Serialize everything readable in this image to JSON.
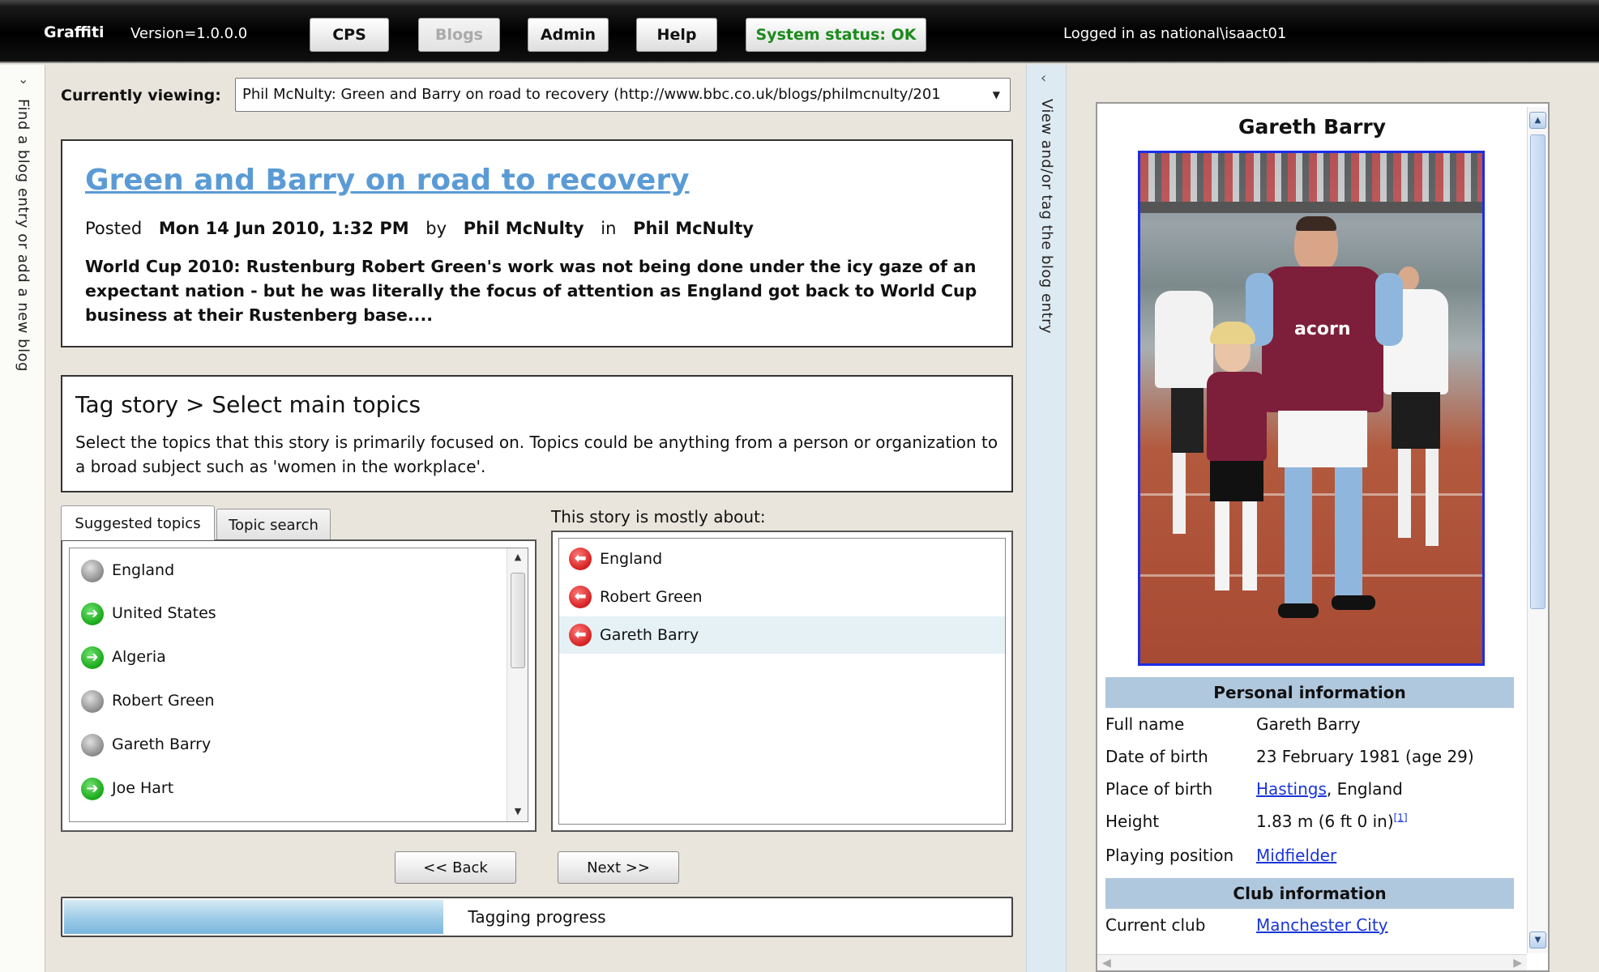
{
  "app": {
    "name": "Graffiti",
    "version": "Version=1.0.0.0",
    "nav": [
      "CPS",
      "Blogs",
      "Admin",
      "Help"
    ],
    "status": "System status: OK",
    "logged_in": "Logged in as national\\isaact01"
  },
  "rails": {
    "left": "Find a blog entry or add a new blog",
    "middle": "View and/or tag the blog entry"
  },
  "viewing": {
    "label": "Currently viewing:",
    "value": "Phil McNulty: Green and Barry on road to recovery (http://www.bbc.co.uk/blogs/philmcnulty/201"
  },
  "article": {
    "title": "Green and Barry on road to recovery",
    "posted_label": "Posted",
    "date": "Mon 14 Jun 2010, 1:32 PM",
    "by_label": "by",
    "author": "Phil McNulty",
    "in_label": "in",
    "blog": "Phil McNulty",
    "summary": "World Cup 2010: Rustenburg Robert Green's work was not being done under the icy gaze of an expectant nation - but he was literally the focus of attention as England got back to World Cup business at their Rustenberg base...."
  },
  "tag_step": {
    "crumb": "Tag story >  Select main topics",
    "description": "Select the topics that this story is primarily focused on. Topics could be anything from a person or organization to a broad subject such as 'women in the workplace'."
  },
  "tabs": [
    "Suggested topics",
    "Topic search"
  ],
  "suggested": [
    {
      "label": "England",
      "state": "grey"
    },
    {
      "label": "United States",
      "state": "green"
    },
    {
      "label": "Algeria",
      "state": "green"
    },
    {
      "label": "Robert Green",
      "state": "grey"
    },
    {
      "label": "Gareth Barry",
      "state": "grey"
    },
    {
      "label": "Joe Hart",
      "state": "green"
    }
  ],
  "about": {
    "label": "This story is mostly about:",
    "items": [
      "England",
      "Robert Green",
      "Gareth Barry"
    ]
  },
  "buttons": {
    "back": "<< Back",
    "next": "Next >>"
  },
  "progress": {
    "label": "Tagging progress",
    "fraction": 0.4
  },
  "wiki": {
    "name": "Gareth Barry",
    "personal_header": "Personal information",
    "full_name_k": "Full name",
    "full_name_v": "Gareth Barry",
    "dob_k": "Date of birth",
    "dob_v": "23 February 1981 (age 29)",
    "pob_k": "Place of birth",
    "pob_link": "Hastings",
    "pob_rest": ", England",
    "height_k": "Height",
    "height_v": "1.83 m (6 ft 0 in)",
    "height_ref": "[1]",
    "position_k": "Playing position",
    "position_v": "Midfielder",
    "club_header": "Club information",
    "club_k": "Current club",
    "club_v": "Manchester City"
  }
}
